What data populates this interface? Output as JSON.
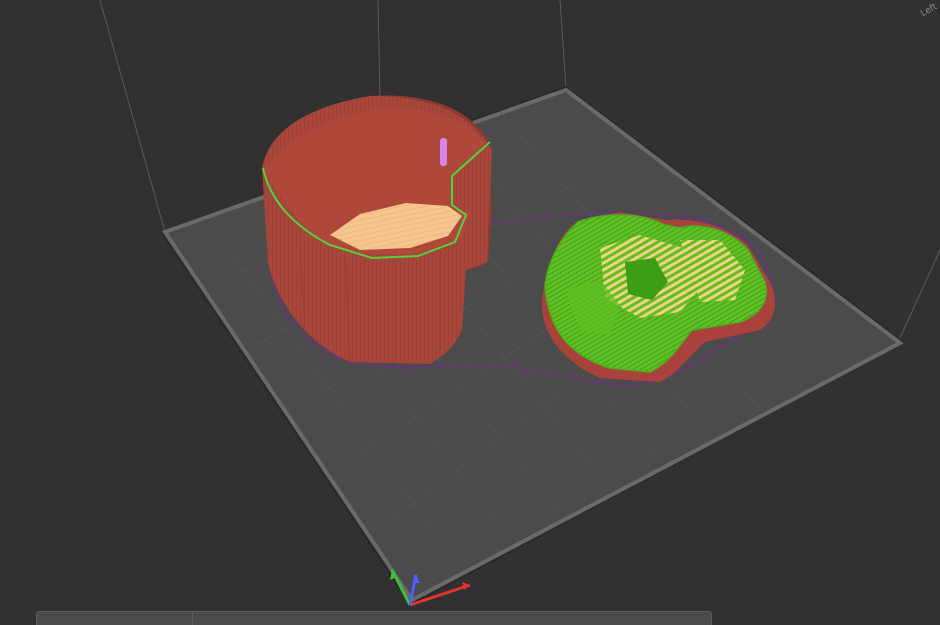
{
  "viewport": {
    "background": "#313131",
    "bed_color": "#4b4b4b",
    "bed_edge_color": "#6a6a6a",
    "bed_grid_color": "#565656"
  },
  "corner_label": "Left",
  "objects": {
    "box": {
      "wall_color": "#a7463a",
      "wall_dark_color": "#8e3a31",
      "top_fill_color": "#f4c68e",
      "perimeter_color": "#55d13a",
      "seam_marker_color": "#d487e6"
    },
    "lid": {
      "perimeter_color": "#57c021",
      "infill_color": "#f4d184",
      "side_color": "#a8423a"
    },
    "skirt_color": "#7a2a88"
  },
  "axes": {
    "x_color": "#e63232",
    "y_color": "#3bc43b",
    "z_color": "#4a63ff"
  }
}
